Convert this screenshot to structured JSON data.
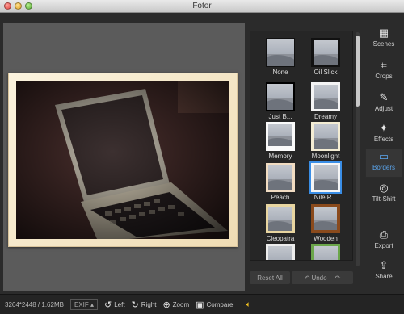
{
  "window": {
    "title": "Fotor"
  },
  "borders": [
    {
      "label": "None"
    },
    {
      "label": "Oil Slick"
    },
    {
      "label": "Just B..."
    },
    {
      "label": "Dreamy"
    },
    {
      "label": "Memory"
    },
    {
      "label": "Moonlight"
    },
    {
      "label": "Peach"
    },
    {
      "label": "Nile R..."
    },
    {
      "label": "Cleopatra"
    },
    {
      "label": "Wooden"
    },
    {
      "label": ""
    },
    {
      "label": ""
    }
  ],
  "panel": {
    "reset_label": "Reset All",
    "undo_label": "Undo"
  },
  "rail": [
    {
      "label": "Scenes",
      "icon": "scenes-icon"
    },
    {
      "label": "Crops",
      "icon": "crop-icon"
    },
    {
      "label": "Adjust",
      "icon": "brush-icon"
    },
    {
      "label": "Effects",
      "icon": "sparkle-icon"
    },
    {
      "label": "Borders",
      "icon": "border-icon"
    },
    {
      "label": "Tilt-Shift",
      "icon": "target-icon"
    },
    {
      "label": "Export",
      "icon": "export-icon"
    },
    {
      "label": "Share",
      "icon": "share-icon"
    }
  ],
  "status": {
    "info": "3264*2448 / 1.62MB",
    "exif": "EXIF",
    "left": "Left",
    "right": "Right",
    "zoom": "Zoom",
    "compare": "Compare"
  },
  "colors": {
    "accent": "#3a8ee6",
    "volume": "#f0c020"
  }
}
